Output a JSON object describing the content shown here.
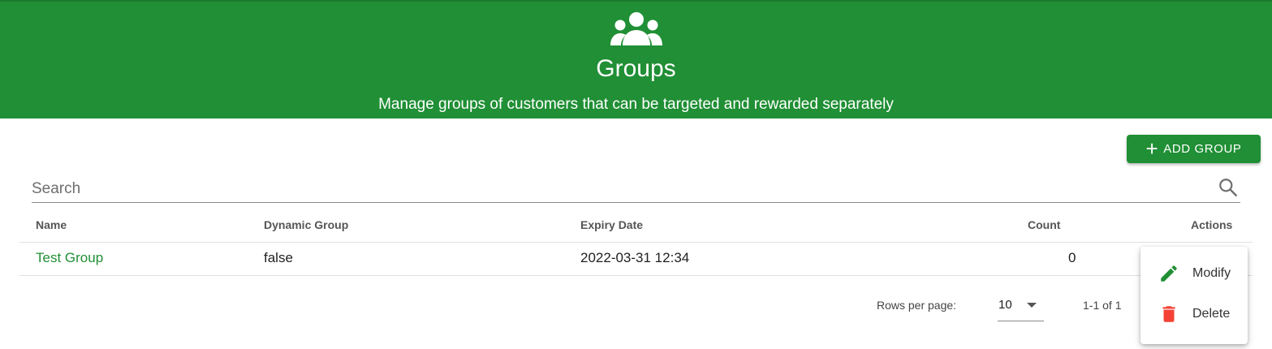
{
  "header": {
    "icon": "people-group-icon",
    "title": "Groups",
    "subtitle": "Manage groups of customers that can be targeted and rewarded separately"
  },
  "toolbar": {
    "add_label": "ADD GROUP",
    "add_icon": "plus-icon"
  },
  "search": {
    "placeholder": "Search",
    "value": "",
    "icon": "search-icon"
  },
  "table": {
    "columns": [
      "Name",
      "Dynamic Group",
      "Expiry Date",
      "Count",
      "Actions"
    ],
    "rows": [
      {
        "name": "Test Group",
        "dynamic": "false",
        "expiry": "2022-03-31 12:34",
        "count": "0"
      }
    ]
  },
  "pagination": {
    "rows_label": "Rows per page:",
    "rows_value": "10",
    "range": "1-1 of 1"
  },
  "actions_menu": {
    "items": [
      {
        "label": "Modify",
        "icon": "pencil-icon"
      },
      {
        "label": "Delete",
        "icon": "trash-icon"
      }
    ]
  },
  "colors": {
    "brand_green": "#208f35",
    "delete_red": "#f44336"
  }
}
